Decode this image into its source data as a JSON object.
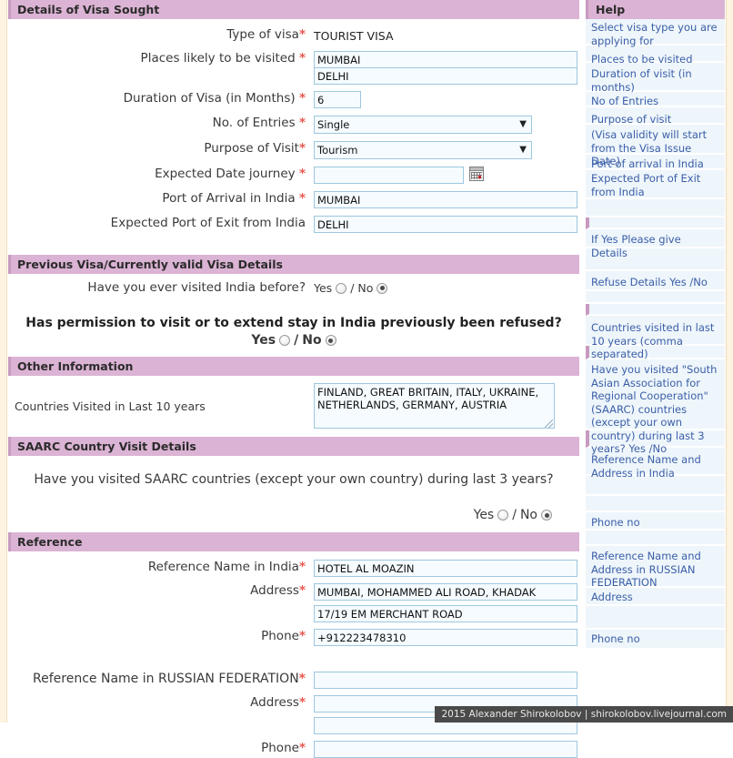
{
  "sections": {
    "visa_sought": "Details of Visa Sought",
    "previous_visa": "Previous Visa/Currently valid Visa Details",
    "other_info": "Other Information",
    "saarc": "SAARC Country Visit Details",
    "reference": "Reference",
    "help": "Help"
  },
  "visa_sought": {
    "type_of_visa_label": "Type of visa",
    "type_of_visa_value": "TOURIST VISA",
    "places_label": "Places likely to be visited ",
    "places_1": "MUMBAI",
    "places_2": "DELHI",
    "duration_label": "Duration of Visa (in Months) ",
    "duration_value": "6",
    "entries_label": "No. of Entries ",
    "entries_value": "Single",
    "purpose_label": "Purpose of Visit",
    "purpose_value": "Tourism",
    "date_label": "Expected Date journey ",
    "date_value": "",
    "port_arrival_label": "Port of Arrival in India ",
    "port_arrival_value": "MUMBAI",
    "port_exit_label": "Expected Port of Exit from India",
    "port_exit_value": "DELHI"
  },
  "previous_visa": {
    "visited_before_question": "Have you ever visited India before?",
    "refused_question": "Has permission to visit or to extend stay in India previously been refused?",
    "yes_label": "Yes",
    "no_label": "No",
    "separator": "/",
    "visited_before_answer": "No",
    "refused_answer": "No"
  },
  "other_info": {
    "countries_label": "Countries Visited in Last 10 years",
    "countries_value": "FINLAND, GREAT BRITAIN, ITALY, UKRAINE, NETHERLANDS, GERMANY, AUSTRIA"
  },
  "saarc": {
    "question": "Have you visited SAARC countries (except your own country) during last 3 years?",
    "yes_label": "Yes",
    "no_label": "No",
    "separator": "/",
    "answer": "No"
  },
  "reference": {
    "india_name_label": "Reference Name in India",
    "india_name_value": "HOTEL AL MOAZIN",
    "india_address_label": "Address",
    "india_address_1": "MUMBAI, MOHAMMED ALI ROAD, KHADAK",
    "india_address_2": "17/19 EM MERCHANT ROAD",
    "india_phone_label": "Phone",
    "india_phone_value": "+912223478310",
    "foreign_name_label": "Reference Name in RUSSIAN FEDERATION",
    "foreign_name_value": "",
    "foreign_address_label": "Address",
    "foreign_address_1": "",
    "foreign_address_2": "",
    "foreign_phone_label": "Phone",
    "foreign_phone_value": ""
  },
  "help_items": [
    "Select visa type you are applying for",
    "Places to be visited",
    "Duration of visit (in months)",
    "No of Entries",
    "Purpose of visit",
    "(Visa validity will start from the Visa Issue Date)",
    "Port of arrival in India",
    "Expected Port of Exit from India",
    "If Yes Please give Details",
    "Refuse Details Yes /No",
    "Countries visited in last 10 years (comma separated)",
    "Have you visited \"South Asian Association for Regional Cooperation\" (SAARC) countries (except your own country) during last 3 years? Yes /No",
    "Reference Name and Address in India",
    "Phone no",
    "Reference Name and Address in RUSSIAN FEDERATION",
    "Address",
    "Phone no"
  ],
  "watermark": "2015 Alexander Shirokolobov | shirokolobov.livejournal.com",
  "colors": {
    "section_header_bg": "#dbb3d4",
    "help_text": "#3b5ea8",
    "help_cell_bg": "#eef6fb",
    "required_star": "#e8584f",
    "input_border": "#9ec7de",
    "input_bg": "#f5fbff",
    "gutter": "#fdf3e0"
  }
}
